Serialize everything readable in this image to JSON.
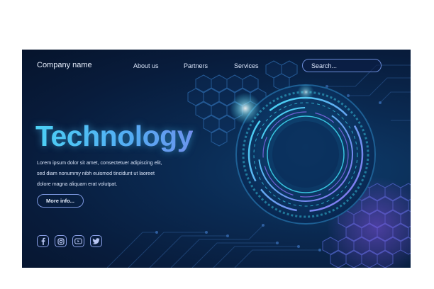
{
  "header": {
    "company_name": "Company name",
    "nav": [
      {
        "label": "About us"
      },
      {
        "label": "Partners"
      },
      {
        "label": "Services"
      }
    ],
    "search": {
      "placeholder": "Search..."
    }
  },
  "hero": {
    "title": "Technology",
    "body_lines": [
      "Lorem ipsum dolor sit amet, consectetuer adipiscing elit,",
      "sed diam nonummy nibh euismod tincidunt ut laoreet",
      "dolore magna aliquam erat volutpat."
    ],
    "button_label": "More info..."
  },
  "social": [
    {
      "icon": "facebook-icon"
    },
    {
      "icon": "instagram-icon"
    },
    {
      "icon": "youtube-icon"
    },
    {
      "icon": "twitter-icon"
    }
  ],
  "colors": {
    "background": "#081c3c",
    "title_gradient_start": "#4fd6f5",
    "title_gradient_end": "#7a86ea",
    "ring_cyan": "#3fd9f2",
    "ring_purple": "#8a6cf0"
  }
}
